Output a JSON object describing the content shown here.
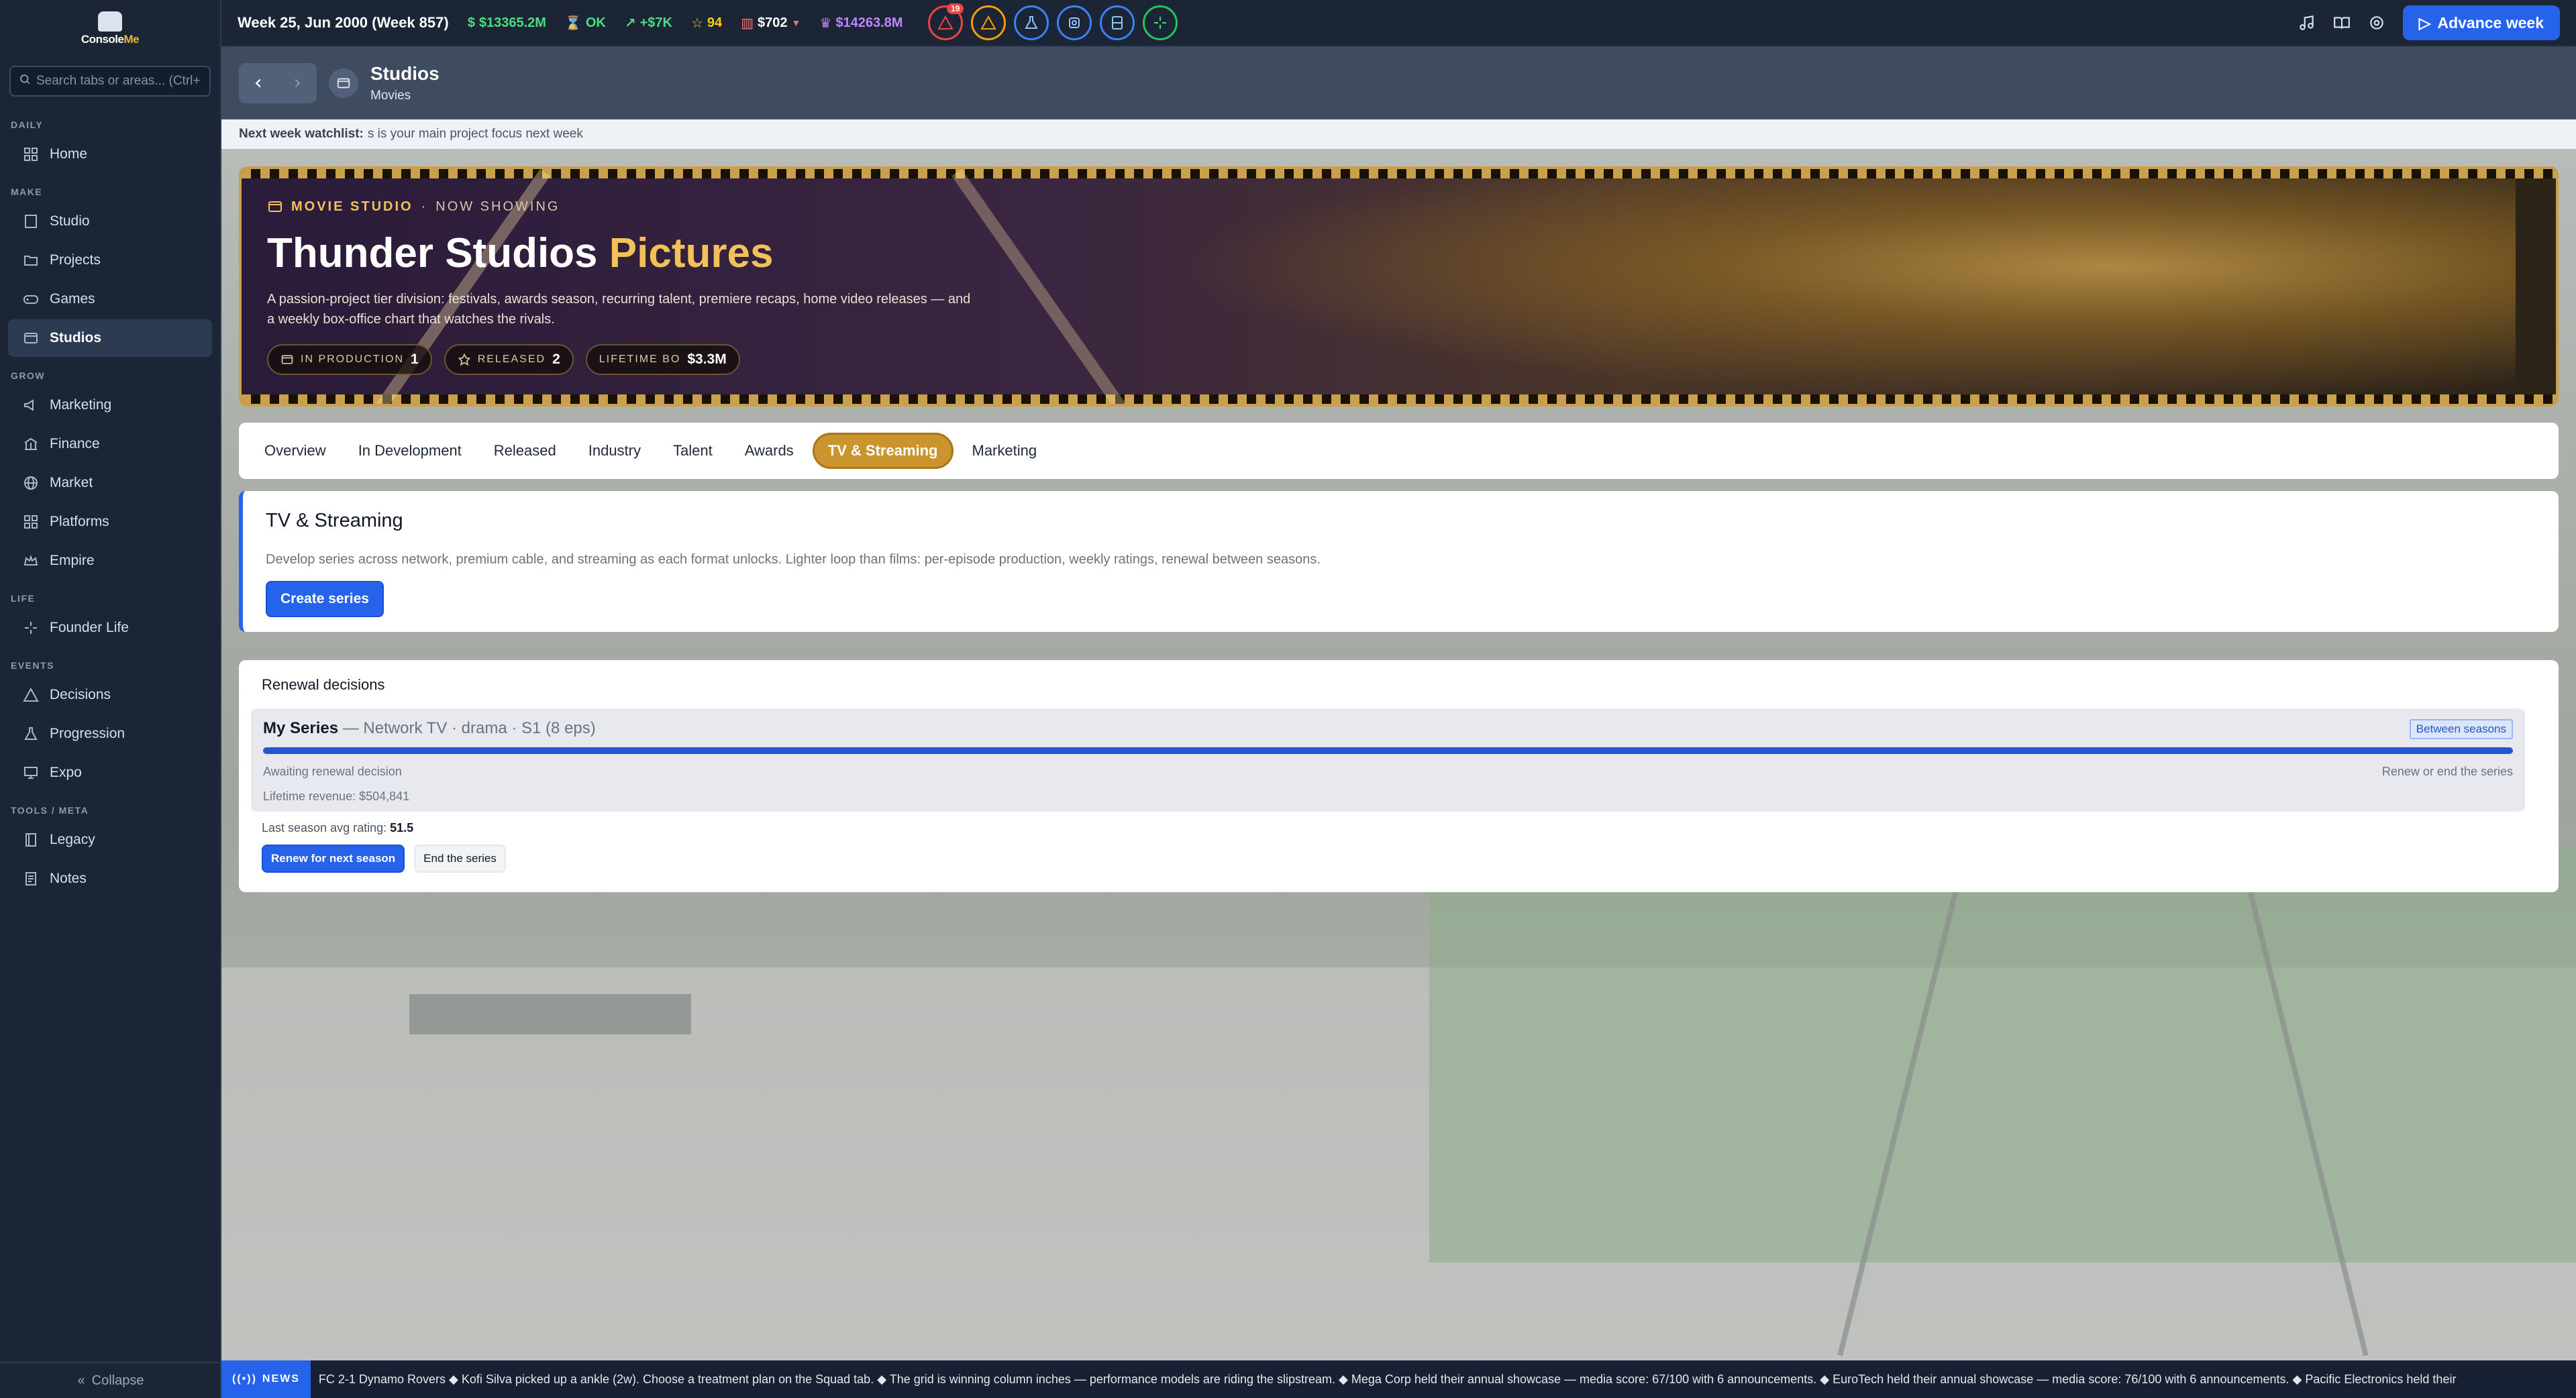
{
  "app": {
    "logo_text_a": "Console",
    "logo_text_b": "Me"
  },
  "sidebar": {
    "search_placeholder": "Search tabs or areas... (Ctrl+K)",
    "sections": {
      "daily": "DAILY",
      "make": "MAKE",
      "grow": "GROW",
      "life": "LIFE",
      "events": "EVENTS",
      "tools": "TOOLS / META"
    },
    "items": {
      "home": "Home",
      "studio": "Studio",
      "projects": "Projects",
      "games": "Games",
      "studios": "Studios",
      "marketing": "Marketing",
      "finance": "Finance",
      "market": "Market",
      "platforms": "Platforms",
      "empire": "Empire",
      "founder_life": "Founder Life",
      "decisions": "Decisions",
      "progression": "Progression",
      "expo": "Expo",
      "legacy": "Legacy",
      "notes": "Notes"
    },
    "collapse_label": "Collapse"
  },
  "topbar": {
    "week": "Week 25, Jun 2000 (Week 857)",
    "cash": "$13365.2M",
    "status": "OK",
    "delta": "+$7K",
    "reputation": "94",
    "price": "$702",
    "valuation": "$14263.8M",
    "alert_count": "19",
    "advance_label": "Advance week"
  },
  "page": {
    "title": "Studios",
    "subtitle": "Movies",
    "watchlist_label": "Next week watchlist:",
    "watchlist_text": "s is your main project focus next week"
  },
  "hero": {
    "kicker": "MOVIE STUDIO",
    "kicker_sep": "·",
    "kicker_status": "NOW SHOWING",
    "title_main": "Thunder Studios",
    "title_accent": "Pictures",
    "description": "A passion-project tier division: festivals, awards season, recurring talent, premiere recaps, home video releases — and a weekly box-office chart that watches the rivals.",
    "pills": {
      "in_production_label": "IN PRODUCTION",
      "in_production_value": "1",
      "released_label": "RELEASED",
      "released_value": "2",
      "lifetime_label": "LIFETIME BO",
      "lifetime_value": "$3.3M"
    }
  },
  "tabs": {
    "overview": "Overview",
    "in_development": "In Development",
    "released": "Released",
    "industry": "Industry",
    "talent": "Talent",
    "awards": "Awards",
    "tv_streaming": "TV & Streaming",
    "marketing": "Marketing"
  },
  "tv": {
    "title": "TV & Streaming",
    "description": "Develop series across network, premium cable, and streaming as each format unlocks. Lighter loop than films: per-episode production, weekly ratings, renewal between seasons.",
    "create_label": "Create series"
  },
  "renewal": {
    "title": "Renewal decisions",
    "series_name": "My Series",
    "series_meta": "— Network TV · drama · S1 (8 eps)",
    "badge": "Between seasons",
    "progress": 1.0,
    "status_left": "Awaiting renewal decision",
    "status_right": "Renew or end the series",
    "lifetime": "Lifetime revenue: $504,841",
    "avg_label": "Last season avg rating:",
    "avg_value": "51.5",
    "renew_label": "Renew for next season",
    "end_label": "End the series"
  },
  "news": {
    "tag": "NEWS",
    "text": "FC 2-1 Dynamo Rovers ◆ Kofi Silva picked up a ankle (2w). Choose a treatment plan on the Squad tab. ◆ The grid is winning column inches — performance models are riding the slipstream. ◆ Mega Corp held their annual showcase — media score: 67/100 with 6 announcements. ◆ EuroTech held their annual showcase — media score: 76/100 with 6 announcements. ◆ Pacific Electronics held their"
  }
}
